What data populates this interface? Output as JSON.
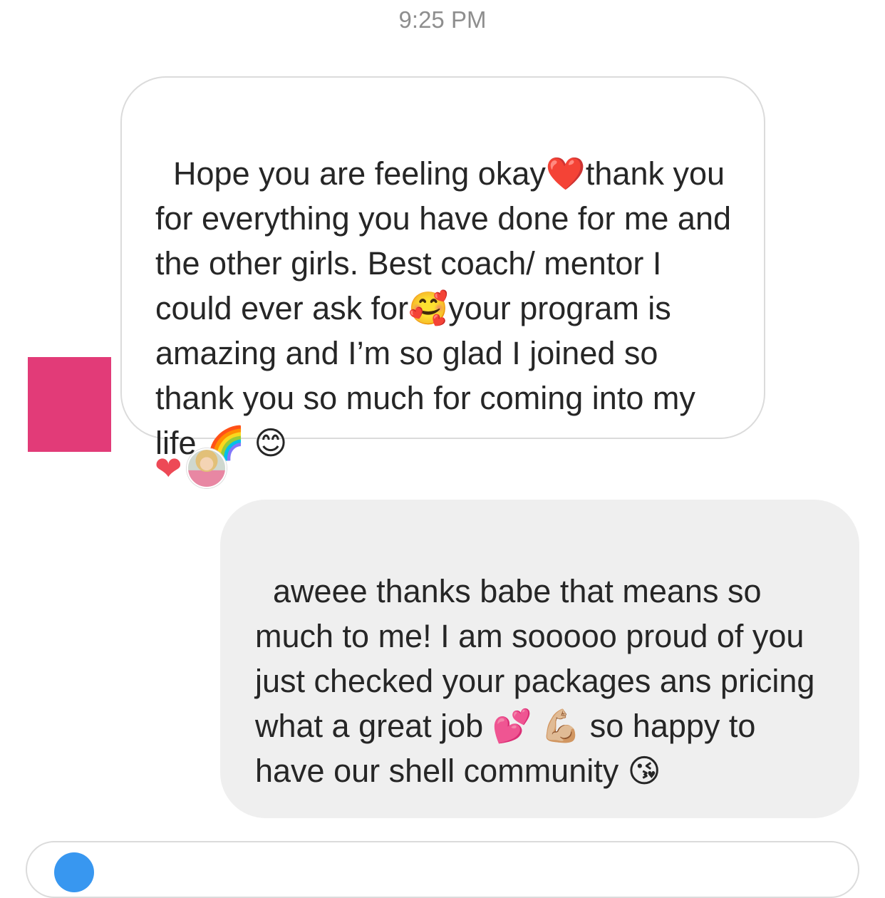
{
  "thread": {
    "timestamp": "9:25 PM"
  },
  "messages": [
    {
      "direction": "incoming",
      "text": "Hope you are feeling okay❤️thank you for everything you have done for me and the other girls. Best coach/ mentor I could ever ask for🥰your program is amazing and I’m so glad I joined so thank you so much for coming into my life 🌈 😊",
      "reactions": [
        {
          "emoji": "❤"
        }
      ]
    },
    {
      "direction": "outgoing",
      "text": "aweee thanks babe that means so much to me! I am sooooo proud of you just checked your packages ans pricing what a great job 💕 💪🏼 so happy to have our shell community 😘"
    }
  ],
  "colors": {
    "avatar_block": "#e23b78",
    "incoming_border": "#dbdbdb",
    "outgoing_bg": "#efefef",
    "heart": "#ed4956",
    "timestamp": "#8e8e8e"
  },
  "icons": {
    "reaction": "heart-icon",
    "composer": "camera-icon"
  }
}
